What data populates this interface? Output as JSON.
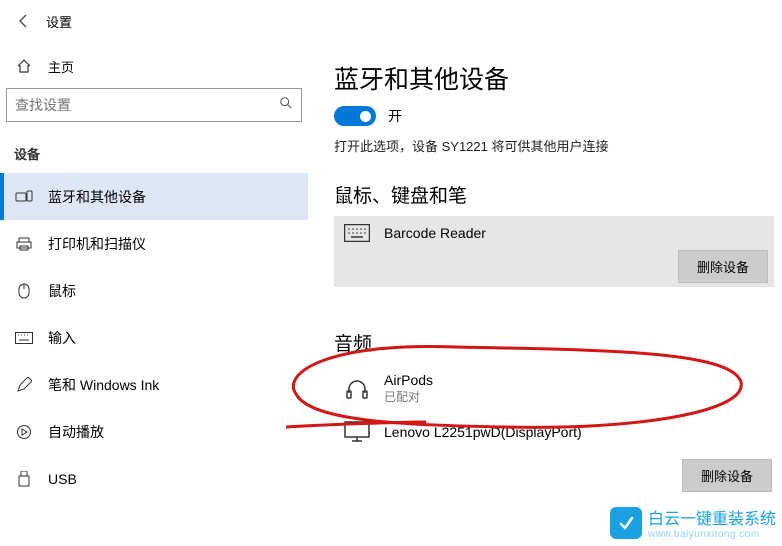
{
  "header": {
    "title": "设置"
  },
  "sidebar": {
    "home": "主页",
    "search_placeholder": "查找设置",
    "section": "设备",
    "items": [
      {
        "label": "蓝牙和其他设备"
      },
      {
        "label": "打印机和扫描仪"
      },
      {
        "label": "鼠标"
      },
      {
        "label": "输入"
      },
      {
        "label": "笔和 Windows Ink"
      },
      {
        "label": "自动播放"
      },
      {
        "label": "USB"
      }
    ]
  },
  "main": {
    "title": "蓝牙和其他设备",
    "toggle_state": "开",
    "desc": "打开此选项，设备 SY1221 将可供其他用户连接",
    "cat1": "鼠标、键盘和笔",
    "device1": {
      "name": "Barcode Reader"
    },
    "remove": "删除设备",
    "cat2": "音频",
    "device2": {
      "name": "AirPods",
      "status": "已配对"
    },
    "device3": {
      "name": "Lenovo L2251pwD(DisplayPort)"
    }
  },
  "watermark": {
    "line1": "白云一键重装系统",
    "line2": "www.baiyunxitong.com"
  }
}
